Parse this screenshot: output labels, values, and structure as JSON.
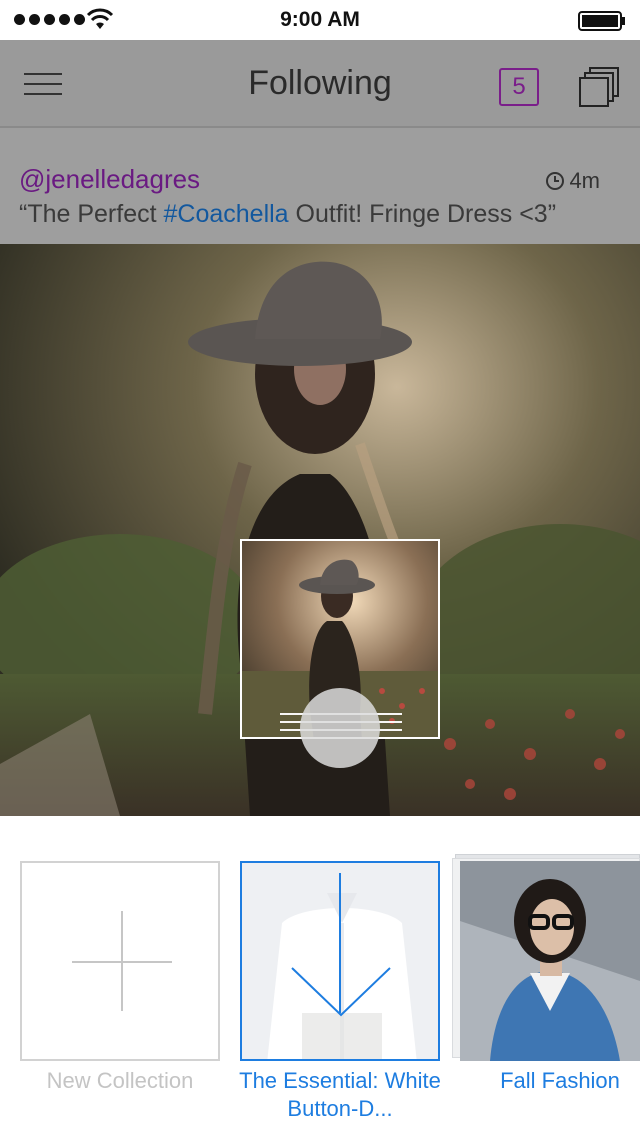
{
  "status_bar": {
    "time": "9:00 AM",
    "signal_icon": "signal-dots-icon",
    "wifi_icon": "wifi-icon",
    "battery_icon": "battery-icon"
  },
  "nav": {
    "title": "Following",
    "menu_icon": "hamburger-menu-icon",
    "badge_count": "5",
    "stack_icon": "stacked-squares-icon"
  },
  "post": {
    "username": "@jenelledagres",
    "time_ago": "4m",
    "caption_prefix": "“The Perfect ",
    "caption_hashtag": "#Coachella",
    "caption_suffix": " Outfit! Fringe Dress <3”"
  },
  "collections": [
    {
      "label": "New Collection",
      "icon": "plus-icon"
    },
    {
      "label": "The Essential: White Button-D...",
      "icon": "down-arrow-icon",
      "selected": true
    },
    {
      "label": "Fall Fashion"
    }
  ],
  "colors": {
    "accent_purple": "#7a1e8a",
    "accent_blue": "#1e7de0",
    "hashtag_blue": "#13589e"
  }
}
